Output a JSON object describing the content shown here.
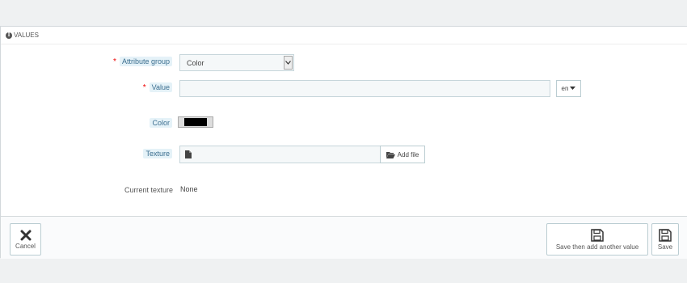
{
  "panel": {
    "title": "VALUES"
  },
  "form": {
    "attribute_group": {
      "label": "Attribute group",
      "required_mark": "*",
      "value": "Color"
    },
    "value": {
      "label": "Value",
      "required_mark": "*",
      "lang": "en"
    },
    "color": {
      "label": "Color",
      "swatch_color": "#000000"
    },
    "texture": {
      "label": "Texture",
      "add_file_label": "Add file"
    },
    "current_texture": {
      "label": "Current texture",
      "value": "None"
    }
  },
  "footer": {
    "cancel_label": "Cancel",
    "save_add_label": "Save then add another value",
    "save_label": "Save"
  }
}
